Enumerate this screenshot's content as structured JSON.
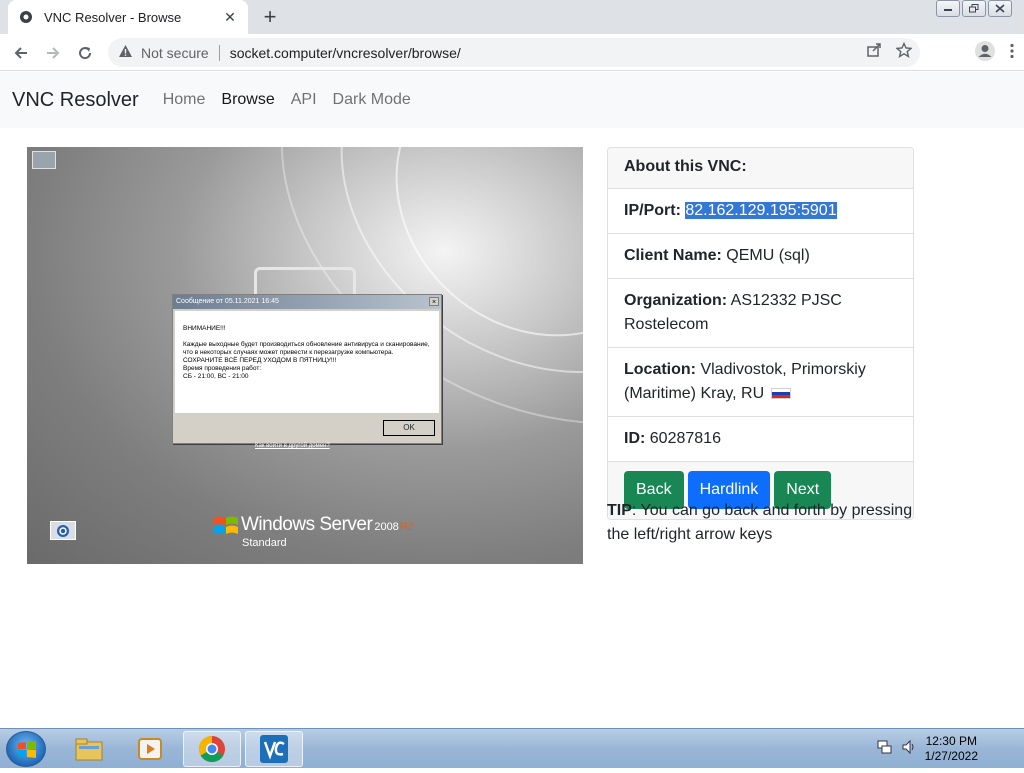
{
  "browser": {
    "tab_title": "VNC Resolver - Browse",
    "new_tab": "+",
    "close_tab": "✕",
    "security_label": "Not secure",
    "url": "socket.computer/vncresolver/browse/"
  },
  "site": {
    "brand": "VNC Resolver",
    "nav": [
      "Home",
      "Browse",
      "API",
      "Dark Mode"
    ],
    "active_nav": "Browse"
  },
  "remote_screen": {
    "dialog_caption": "Сообщение от  05.11.2021 16:45",
    "dialog_heading": "ВНИМАНИЕ!!!",
    "dialog_text_1": "Каждые выходные будет производиться обновление антивируса и сканирование, что в некоторых случаях может привести к перезагрузке компьютера. СОХРАНИТЕ ВСЁ ПЕРЕД УХОДОМ В ПЯТНИЦУ!!!",
    "dialog_text_2": "Время проведения работ:",
    "dialog_text_3": "СБ - 21:00, ВС - 21:00",
    "ok_label": "OK",
    "login_hint": "Как войти в другой домен?",
    "os_name": "Windows Server",
    "os_version": "2008",
    "os_release": "R2",
    "os_edition": "Standard"
  },
  "vnc_info": {
    "header": "About this VNC:",
    "ip_label": "IP/Port:",
    "ip_value": "82.162.129.195:5901",
    "client_label": "Client Name:",
    "client_value": "QEMU (sql)",
    "org_label": "Organization:",
    "org_value": "AS12332 PJSC Rostelecom",
    "location_label": "Location:",
    "location_value": "Vladivostok, Primorskiy (Maritime) Kray, RU",
    "id_label": "ID:",
    "id_value": "60287816",
    "back_label": "Back",
    "hardlink_label": "Hardlink",
    "next_label": "Next"
  },
  "tip": {
    "label": "TIP",
    "text": ": You can go back and forth by pressing the left/right arrow keys"
  },
  "taskbar": {
    "time": "12:30 PM",
    "date": "1/27/2022"
  }
}
